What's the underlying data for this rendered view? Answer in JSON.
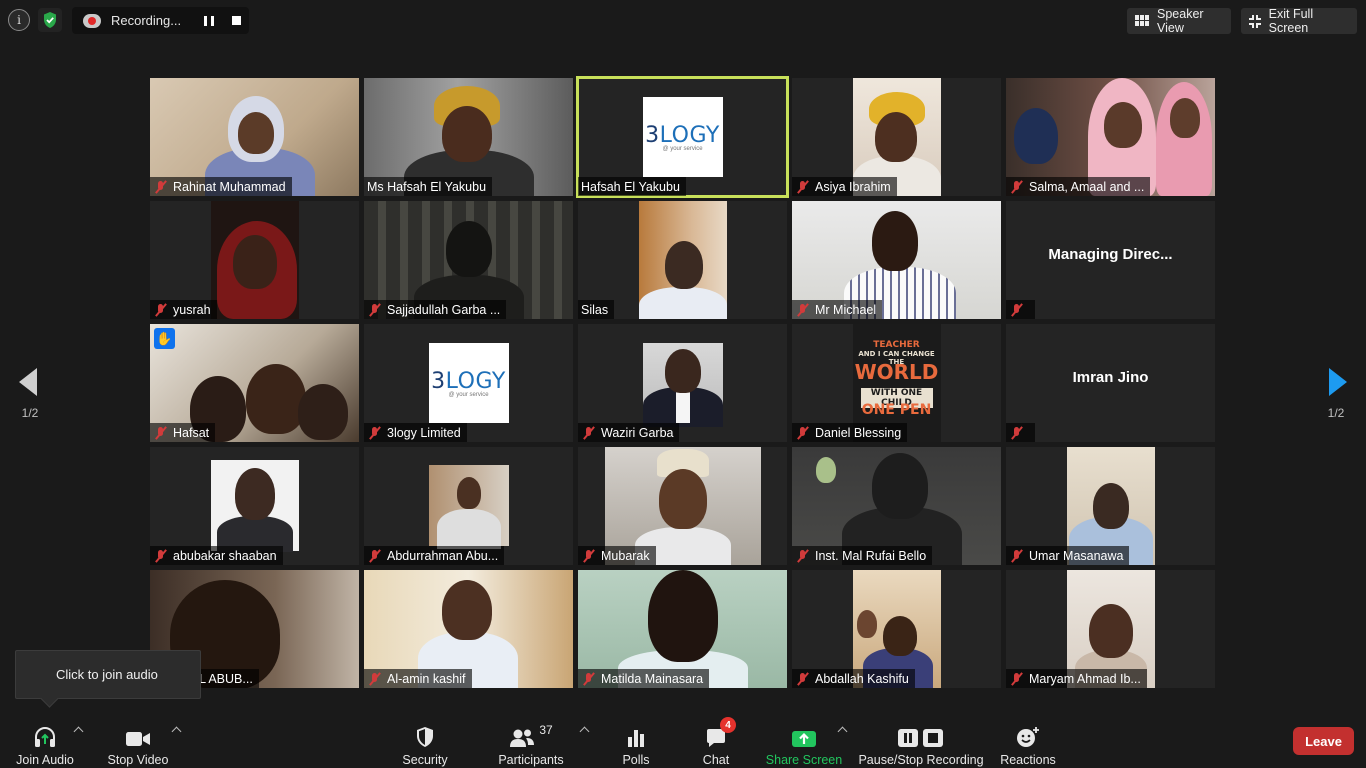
{
  "topbar": {
    "recording_label": "Recording...",
    "speaker_view_label": "Speaker View",
    "exit_fullscreen_label": "Exit Full Screen",
    "encryption_color": "#2aa84a"
  },
  "pager": {
    "prev_page": "1/2",
    "next_page": "1/2"
  },
  "participants": [
    {
      "name": "Rahinat Muhammad",
      "muted": true
    },
    {
      "name": "Ms Hafsah El Yakubu",
      "muted": false
    },
    {
      "name": "Hafsah El Yakubu",
      "muted": false,
      "active_speaker": true,
      "logo": "3logy"
    },
    {
      "name": "Asiya Ibrahim",
      "muted": true
    },
    {
      "name": "Salma, Amaal and ...",
      "muted": true
    },
    {
      "name": "yusrah",
      "muted": true
    },
    {
      "name": "Sajjadullah Garba ...",
      "muted": true
    },
    {
      "name": "Silas",
      "muted": false
    },
    {
      "name": "Mr Michael",
      "muted": true
    },
    {
      "name": "",
      "display_name": "Managing  Direc...",
      "muted": true,
      "video_off": true
    },
    {
      "name": "Hafsat",
      "muted": true,
      "hand_raised": true
    },
    {
      "name": "3logy Limited",
      "muted": true,
      "logo": "3logy"
    },
    {
      "name": "Waziri Garba",
      "muted": true
    },
    {
      "name": "Daniel Blessing",
      "muted": true
    },
    {
      "name": "",
      "display_name": "Imran Jino",
      "muted": true,
      "video_off": true
    },
    {
      "name": "abubakar shaaban",
      "muted": true
    },
    {
      "name": "Abdurrahman Abu...",
      "muted": true
    },
    {
      "name": "Mubarak",
      "muted": true
    },
    {
      "name": "Inst. Mal Rufai Bello",
      "muted": true
    },
    {
      "name": "Umar Masanawa",
      "muted": true
    },
    {
      "name": "RAUWAL ABUB...",
      "muted": false
    },
    {
      "name": "Al-amin  kashif",
      "muted": true
    },
    {
      "name": "Matilda Mainasara",
      "muted": true
    },
    {
      "name": "Abdallah Kashifu",
      "muted": true
    },
    {
      "name": "Maryam Ahmad Ib...",
      "muted": true
    }
  ],
  "logo": {
    "word_a": "3",
    "word_b": "LOGY",
    "tagline": "@ your service"
  },
  "tshirt": {
    "line1": "TEACHER",
    "line2": "AND I CAN CHANGE THE",
    "line3": "WORLD",
    "line4": "WITH ONE CHILD",
    "line5": "ONE PEN"
  },
  "tooltip": {
    "text": "Click to join audio"
  },
  "toolbar": {
    "join_audio": "Join Audio",
    "stop_video": "Stop Video",
    "security": "Security",
    "participants": "Participants",
    "participants_count": "37",
    "polls": "Polls",
    "chat": "Chat",
    "chat_badge": "4",
    "share_screen": "Share Screen",
    "pause_stop_recording": "Pause/Stop Recording",
    "reactions": "Reactions",
    "leave": "Leave"
  }
}
